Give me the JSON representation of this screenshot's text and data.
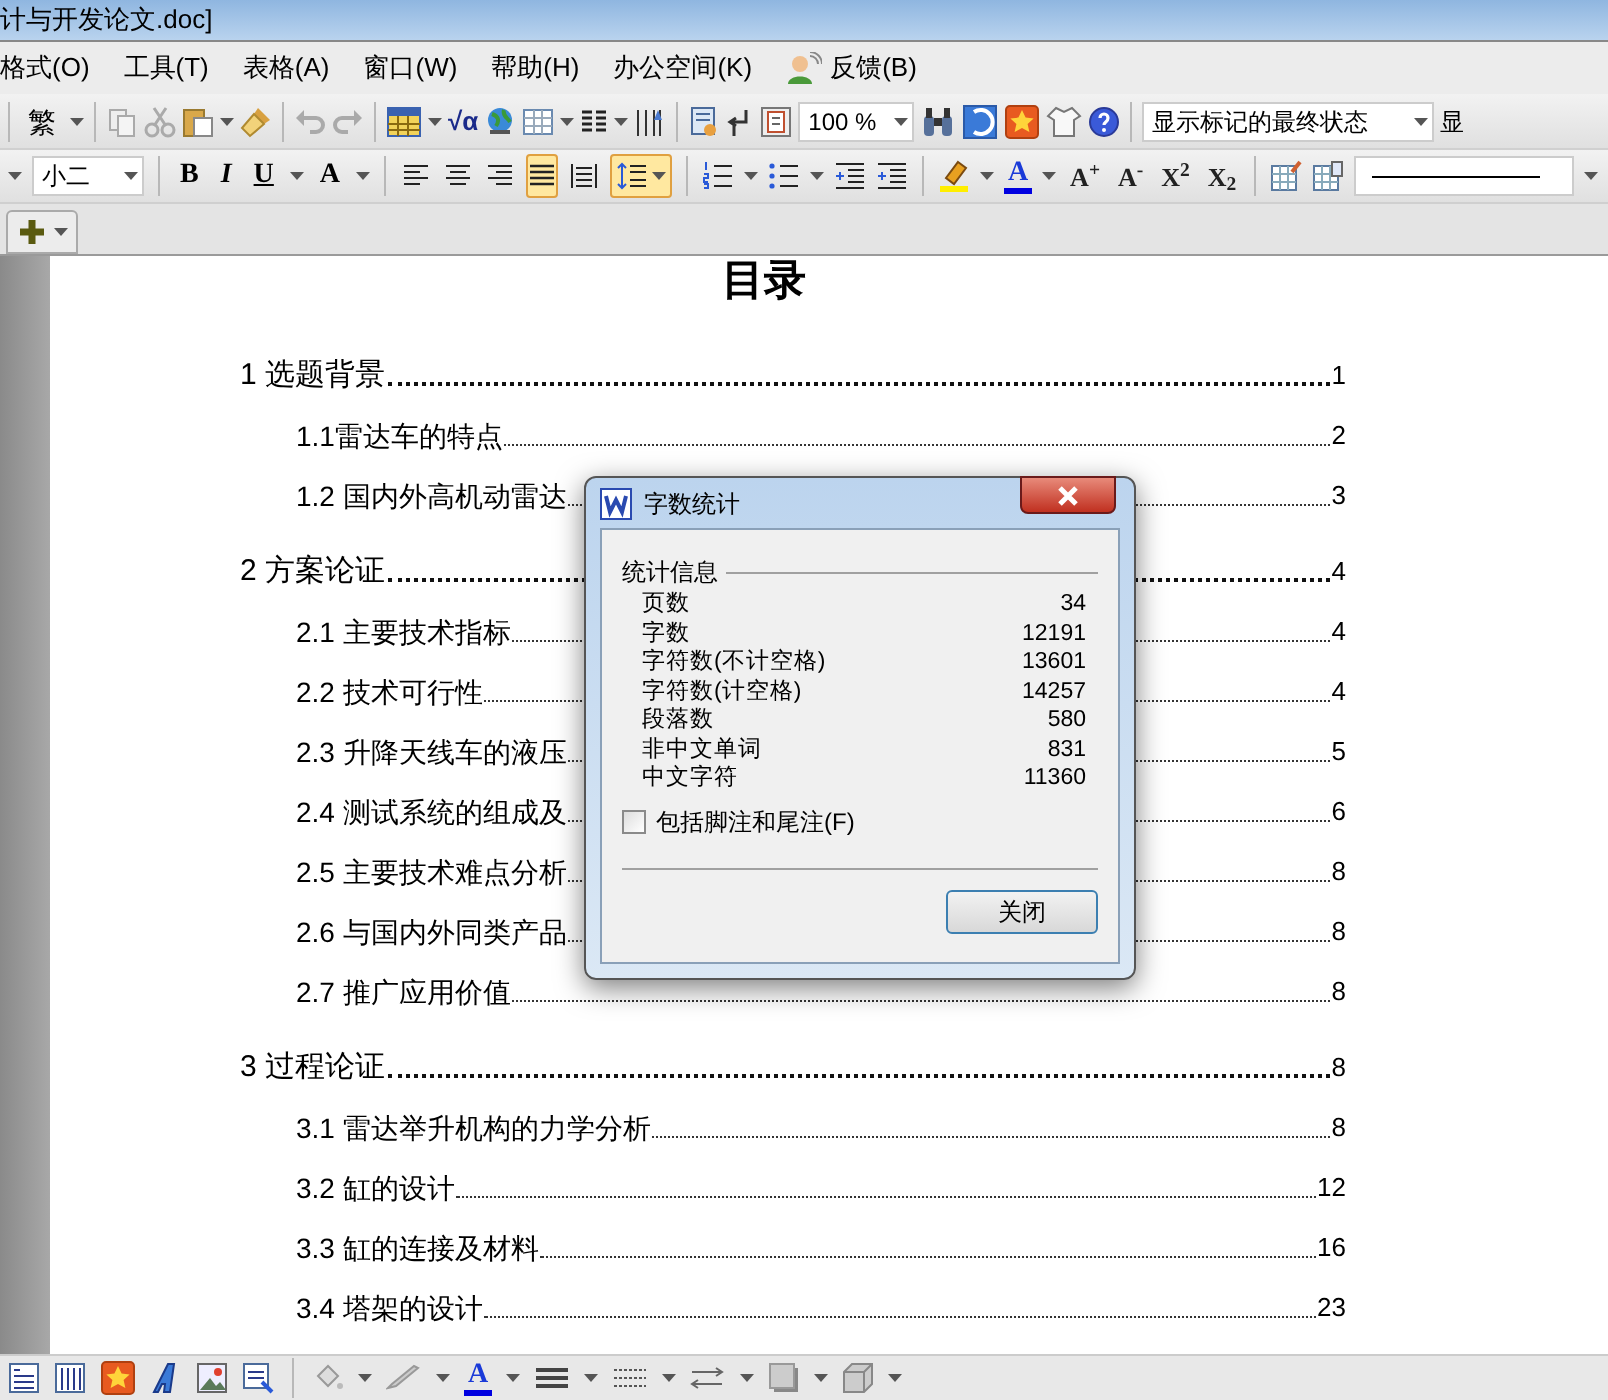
{
  "window": {
    "title": "计与开发论文.doc]"
  },
  "menu": [
    {
      "label": "格式(O)"
    },
    {
      "label": "工具(T)"
    },
    {
      "label": "表格(A)"
    },
    {
      "label": "窗口(W)"
    },
    {
      "label": "帮助(H)"
    },
    {
      "label": "办公空间(K)"
    },
    {
      "label": "反馈(B)",
      "kind": "icon"
    }
  ],
  "toolbar_1": {
    "convert_label": "繁",
    "formula_label": "√α",
    "zoom": "100 %",
    "markup_state": "显示标记的最终状态",
    "cut_off_button": "显"
  },
  "toolbar_2": {
    "font_size": "小二",
    "format_buttons": [
      {
        "label": "B",
        "kind": "bold"
      },
      {
        "label": "I",
        "kind": "italic"
      },
      {
        "label": "U",
        "kind": "underline"
      },
      {
        "label": "A",
        "kind": "plain"
      }
    ],
    "align": [
      {
        "selected": false
      },
      {
        "selected": false
      },
      {
        "selected": false
      },
      {
        "selected": true
      },
      {
        "selected": false
      }
    ],
    "line_spacing": {
      "selected": true
    },
    "font_color_label": "A",
    "scale_buttons": [
      {
        "label": "A$^{+}$"
      },
      {
        "label": "A$^{-}$"
      },
      {
        "label": "X$^{2}$"
      },
      {
        "label": "X$_{2}$"
      }
    ]
  },
  "document": {
    "title": "目录",
    "toc": [
      {
        "label": "1 选题背景",
        "page": "1",
        "children": [
          {
            "label": "1.1雷达车的特点",
            "page": "2"
          },
          {
            "label": "1.2 国内外高机动雷达",
            "page": "3"
          }
        ]
      },
      {
        "label": "2 方案论证",
        "page": "4",
        "children": [
          {
            "label": "2.1 主要技术指标",
            "page": "4"
          },
          {
            "label": "2.2 技术可行性",
            "page": "4"
          },
          {
            "label": "2.3 升降天线车的液压",
            "page": "5"
          },
          {
            "label": "2.4 测试系统的组成及",
            "page": "6"
          },
          {
            "label": "2.5 主要技术难点分析",
            "page": "8"
          },
          {
            "label": "2.6 与国内外同类产品",
            "page": "8"
          },
          {
            "label": "2.7 推广应用价值",
            "page": "8"
          }
        ]
      },
      {
        "label": "3 过程论证",
        "page": "8",
        "children": [
          {
            "label": "3.1 雷达举升机构的力学分析",
            "page": "8"
          },
          {
            "label": "3.2 缸的设计",
            "page": "12"
          },
          {
            "label": "3.3 缸的连接及材料",
            "page": "16"
          },
          {
            "label": "3.4 塔架的设计",
            "page": "23"
          }
        ]
      }
    ]
  },
  "dialog": {
    "title": "字数统计",
    "group": "统计信息",
    "stats": [
      {
        "label": "页数",
        "value": "34"
      },
      {
        "label": "字数",
        "value": "12191"
      },
      {
        "label": "字符数(不计空格)",
        "value": "13601"
      },
      {
        "label": "字符数(计空格)",
        "value": "14257"
      },
      {
        "label": "段落数",
        "value": "580"
      },
      {
        "label": "非中文单词",
        "value": "831"
      },
      {
        "label": "中文字符",
        "value": "11360"
      }
    ],
    "checkbox": {
      "label": "包括脚注和尾注(F)",
      "checked": false
    },
    "button": "关闭"
  },
  "drawing_toolbar": {
    "font_color_label": "A"
  }
}
